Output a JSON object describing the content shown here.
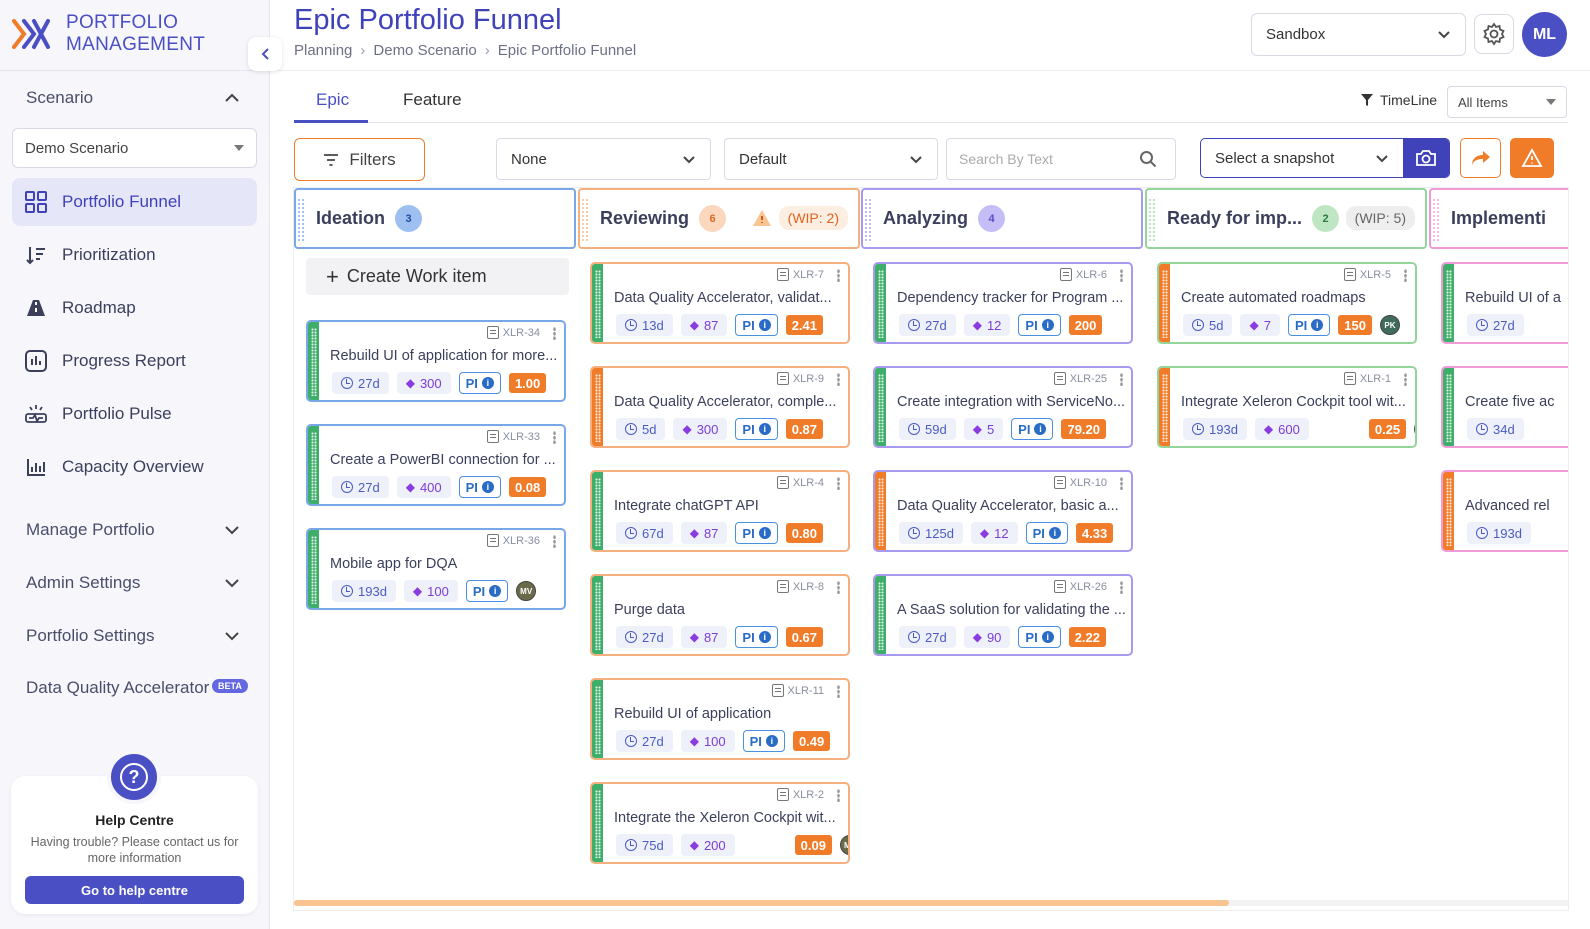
{
  "app": {
    "name_line1": "PORTFOLIO",
    "name_line2": "MANAGEMENT"
  },
  "colors": {
    "brand": "#4b4fc4",
    "accent_orange": "#f07c2a",
    "ideation": "#7aa7e8",
    "reviewing": "#f4b07e",
    "analyzing": "#a79af0",
    "ready": "#93d59a",
    "implementing": "#f09ad6"
  },
  "sidebar": {
    "scenario_section": "Scenario",
    "scenario_select": "Demo Scenario",
    "nav": [
      {
        "label": "Portfolio Funnel",
        "icon": "grid-icon",
        "active": true
      },
      {
        "label": "Prioritization",
        "icon": "sort-icon"
      },
      {
        "label": "Roadmap",
        "icon": "roadmap-icon"
      },
      {
        "label": "Progress Report",
        "icon": "bar-report-icon"
      },
      {
        "label": "Portfolio Pulse",
        "icon": "pulse-icon"
      },
      {
        "label": "Capacity Overview",
        "icon": "capacity-chart-icon"
      }
    ],
    "sections": [
      {
        "label": "Manage Portfolio"
      },
      {
        "label": "Admin Settings"
      },
      {
        "label": "Portfolio Settings"
      }
    ],
    "dqa_label": "Data Quality Accelerator",
    "dqa_badge": "BETA",
    "help": {
      "title": "Help Centre",
      "text": "Having trouble? Please contact us for more information",
      "button": "Go to help centre"
    }
  },
  "header": {
    "title": "Epic Portfolio Funnel",
    "breadcrumb": [
      "Planning",
      "Demo Scenario",
      "Epic Portfolio Funnel"
    ],
    "environment": "Sandbox",
    "user_initials": "ML"
  },
  "tabs": [
    {
      "label": "Epic",
      "active": true
    },
    {
      "label": "Feature",
      "active": false
    }
  ],
  "timeline": {
    "label": "TimeLine",
    "value": "All Items"
  },
  "toolbar": {
    "filters": "Filters",
    "group_by": "None",
    "sort": "Default",
    "search_placeholder": "Search By Text",
    "snapshot": "Select a snapshot"
  },
  "board": {
    "create_label": "Create Work item",
    "columns": [
      {
        "title": "Ideation",
        "count": "3",
        "wip": "",
        "cards": [
          {
            "id": "XLR-34",
            "title": "Rebuild UI of application for more...",
            "duration": "27d",
            "value": "300",
            "pi": "PI",
            "score": "1.00",
            "avatar": ""
          },
          {
            "id": "XLR-33",
            "title": "Create a PowerBI connection for ...",
            "duration": "27d",
            "value": "400",
            "pi": "PI",
            "score": "0.08",
            "avatar": ""
          },
          {
            "id": "XLR-36",
            "title": "Mobile app for DQA",
            "duration": "193d",
            "value": "100",
            "pi": "PI",
            "score": "",
            "avatar": "MV"
          }
        ]
      },
      {
        "title": "Reviewing",
        "count": "6",
        "wip": "(WIP: 2)",
        "cards": [
          {
            "id": "XLR-7",
            "title": "Data Quality Accelerator, validat...",
            "duration": "13d",
            "value": "87",
            "pi": "PI",
            "score": "2.41",
            "avatar": ""
          },
          {
            "id": "XLR-9",
            "title": "Data Quality Accelerator, comple...",
            "duration": "5d",
            "value": "300",
            "pi": "PI",
            "score": "0.87",
            "avatar": ""
          },
          {
            "id": "XLR-4",
            "title": "Integrate chatGPT API",
            "duration": "67d",
            "value": "87",
            "pi": "PI",
            "score": "0.80",
            "avatar": ""
          },
          {
            "id": "XLR-8",
            "title": "Purge data",
            "duration": "27d",
            "value": "87",
            "pi": "PI",
            "score": "0.67",
            "avatar": ""
          },
          {
            "id": "XLR-11",
            "title": "Rebuild UI of application",
            "duration": "27d",
            "value": "100",
            "pi": "PI",
            "score": "0.49",
            "avatar": ""
          },
          {
            "id": "XLR-2",
            "title": "Integrate the Xeleron Cockpit wit...",
            "duration": "75d",
            "value": "200",
            "pi": "",
            "score": "0.09",
            "avatar": "MV"
          }
        ]
      },
      {
        "title": "Analyzing",
        "count": "4",
        "wip": "",
        "cards": [
          {
            "id": "XLR-6",
            "title": "Dependency tracker for Program ...",
            "duration": "27d",
            "value": "12",
            "pi": "PI",
            "score": "200",
            "avatar": ""
          },
          {
            "id": "XLR-25",
            "title": "Create integration with ServiceNo...",
            "duration": "59d",
            "value": "5",
            "pi": "PI",
            "score": "79.20",
            "avatar": ""
          },
          {
            "id": "XLR-10",
            "title": "Data Quality Accelerator, basic a...",
            "duration": "125d",
            "value": "12",
            "pi": "PI",
            "score": "4.33",
            "avatar": ""
          },
          {
            "id": "XLR-26",
            "title": "A SaaS solution for validating the ...",
            "duration": "27d",
            "value": "90",
            "pi": "PI",
            "score": "2.22",
            "avatar": ""
          }
        ]
      },
      {
        "title": "Ready for imp...",
        "count": "2",
        "wip": "(WIP: 5)",
        "cards": [
          {
            "id": "XLR-5",
            "title": "Create automated roadmaps",
            "duration": "5d",
            "value": "7",
            "pi": "PI",
            "score": "150",
            "avatar": "PK"
          },
          {
            "id": "XLR-1",
            "title": "Integrate Xeleron Cockpit tool wit...",
            "duration": "193d",
            "value": "600",
            "pi": "",
            "score": "0.25",
            "avatar": "MV"
          }
        ]
      },
      {
        "title": "Implementi",
        "count": "",
        "wip": "",
        "cards": [
          {
            "id": "",
            "title": "Rebuild UI of a",
            "duration": "27d",
            "value": "",
            "pi": "",
            "score": "",
            "avatar": ""
          },
          {
            "id": "",
            "title": "Create five ac",
            "duration": "34d",
            "value": "",
            "pi": "",
            "score": "",
            "avatar": ""
          },
          {
            "id": "",
            "title": "Advanced rel",
            "duration": "193d",
            "value": "",
            "pi": "",
            "score": "",
            "avatar": ""
          }
        ]
      }
    ]
  }
}
